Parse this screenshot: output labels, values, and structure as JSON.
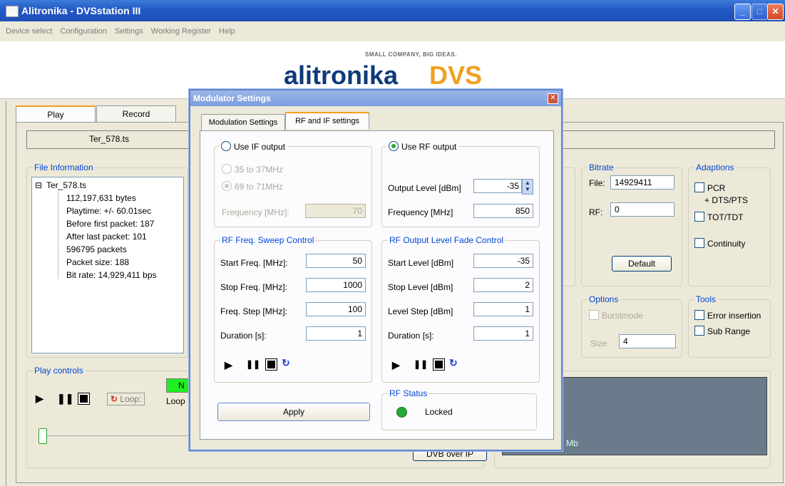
{
  "window": {
    "title": "Alitronika - DVSstation III"
  },
  "menu": [
    "Device select",
    "Configuration",
    "Settings",
    "Working Register",
    "Help"
  ],
  "banner": {
    "slogan": "SMALL COMPANY, BIG IDEAS.",
    "brand_text": "alitronika",
    "brand_dvs": "DVS"
  },
  "main": {
    "tabs": [
      "Play",
      "Record"
    ],
    "filename": "Ter_578.ts",
    "file_info": {
      "label": "File Information",
      "root": "Ter_578.ts",
      "items": [
        "112,197,631 bytes",
        "Playtime: +/- 60.01sec",
        "Before first packet: 187",
        "After last packet: 101",
        "596795 packets",
        "Packet size: 188",
        "Bit rate: 14,929,411 bps"
      ]
    },
    "bitrate": {
      "label": "Bitrate",
      "file_label": "File:",
      "file_value": "14929411",
      "rf_label": "RF:",
      "rf_value": "0",
      "default_button": "Default"
    },
    "adaptions": {
      "label": "Adaptions",
      "pcr": "PCR",
      "pcr_sub": "+ DTS/PTS",
      "tot": "TOT/TDT",
      "continuity": "Continuity"
    },
    "options": {
      "label": "Options",
      "burstmode": "Burstmode",
      "size_label": "Size",
      "size_value": "4"
    },
    "tools": {
      "label": "Tools",
      "error_insertion": "Error insertion",
      "sub_range": "Sub Range"
    },
    "play_controls": {
      "label": "Play controls",
      "loop_label": "Loop:",
      "loop_text": "Loop"
    },
    "status_green": "N",
    "dvb_button": "DVB over IP",
    "graph_text": "Mb"
  },
  "modal": {
    "title": "Modulator Settings",
    "tabs": [
      "Modulation Settings",
      "RF and IF settings"
    ],
    "if_output": {
      "label": "Use IF output",
      "opt1": "35 to 37MHz",
      "opt2": "69 to 71MHz",
      "freq_label": "Frequency [MHz]:",
      "freq_value": "70"
    },
    "rf_output": {
      "label": "Use RF output",
      "level_label": "Output Level [dBm]",
      "level_value": "-35",
      "freq_label": "Frequency [MHz]",
      "freq_value": "850"
    },
    "sweep": {
      "label": "RF Freq. Sweep Control",
      "start_label": "Start Freq. [MHz]:",
      "start_value": "50",
      "stop_label": "Stop Freq. [MHz]:",
      "stop_value": "1000",
      "step_label": "Freq. Step [MHz]:",
      "step_value": "100",
      "dur_label": "Duration [s]:",
      "dur_value": "1"
    },
    "fade": {
      "label": "RF Output  Level Fade Control",
      "start_label": "Start Level [dBm]",
      "start_value": "-35",
      "stop_label": "Stop Level [dBm]",
      "stop_value": "2",
      "step_label": "Level Step [dBm]",
      "step_value": "1",
      "dur_label": "Duration [s]:",
      "dur_value": "1"
    },
    "apply_button": "Apply",
    "status": {
      "label": "RF Status",
      "value": "Locked"
    }
  },
  "colors": {
    "accent": "#0046d5",
    "tab_highlight": "#f0a020",
    "locked": "#25a83a",
    "title_blue": "#2359c6"
  }
}
